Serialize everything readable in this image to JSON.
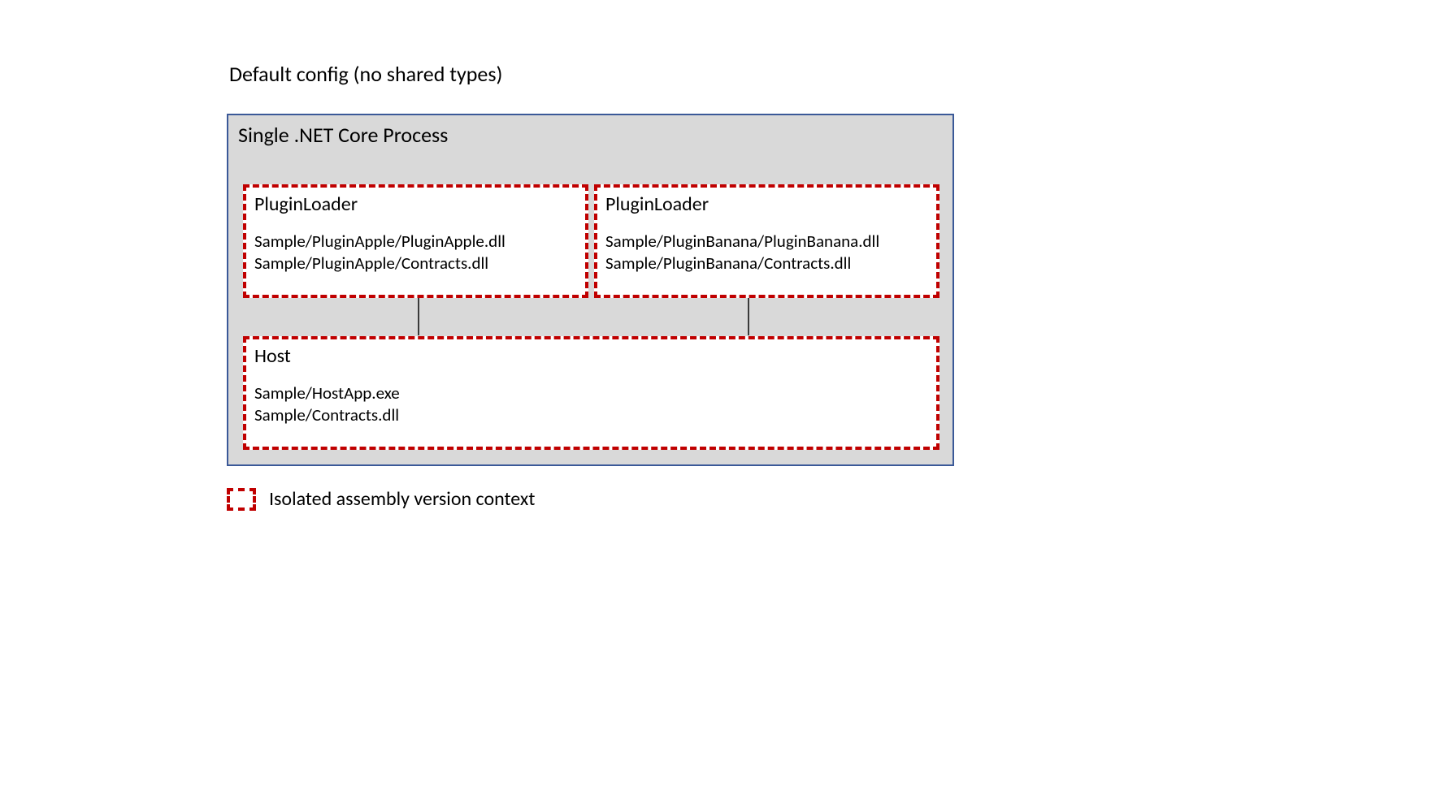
{
  "title": "Default config (no shared types)",
  "process": {
    "title": "Single .NET Core Process"
  },
  "plugins": {
    "left": {
      "title": "PluginLoader",
      "line1": "Sample/PluginApple/PluginApple.dll",
      "line2": "Sample/PluginApple/Contracts.dll"
    },
    "right": {
      "title": "PluginLoader",
      "line1": "Sample/PluginBanana/PluginBanana.dll",
      "line2": "Sample/PluginBanana/Contracts.dll"
    }
  },
  "host": {
    "title": "Host",
    "line1": "Sample/HostApp.exe",
    "line2": "Sample/Contracts.dll"
  },
  "legend": {
    "label": "Isolated assembly version context"
  }
}
